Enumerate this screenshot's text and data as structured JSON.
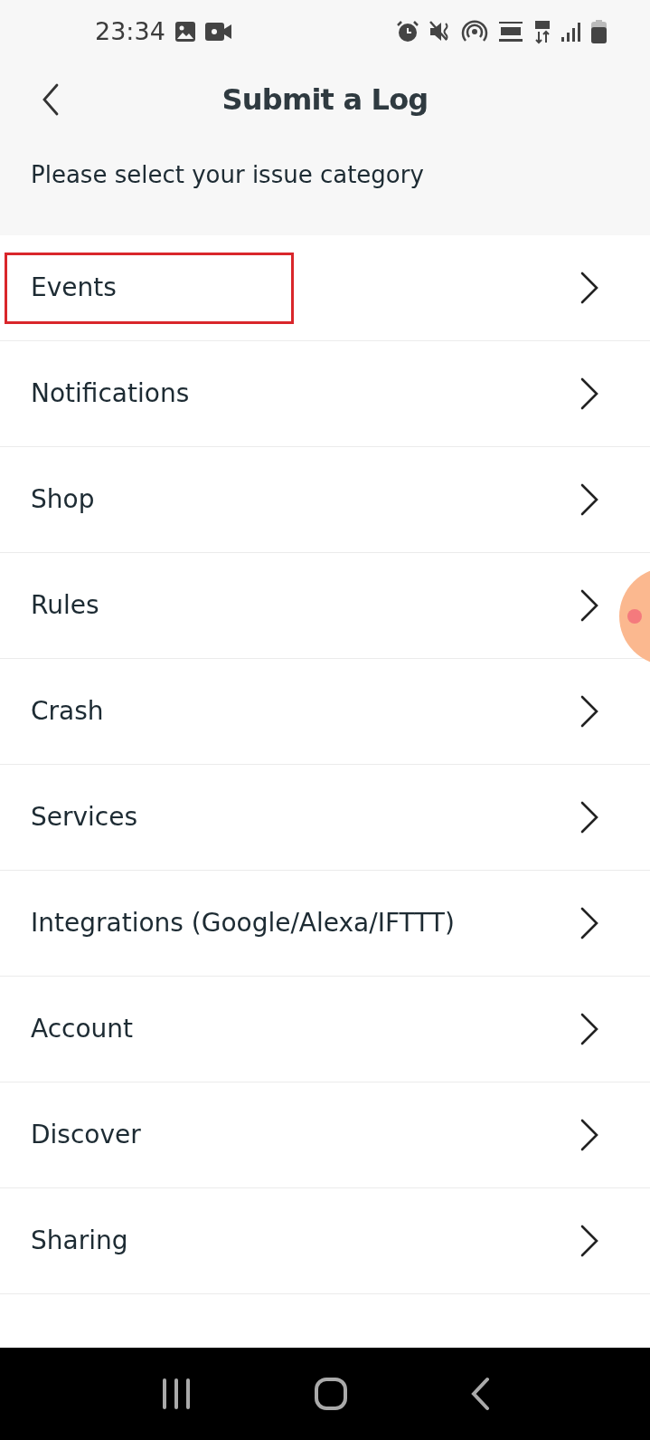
{
  "status_bar": {
    "time": "23:34"
  },
  "header": {
    "title": "Submit a Log",
    "subtitle": "Please select your issue category"
  },
  "categories": [
    {
      "label": "Events",
      "highlighted": true
    },
    {
      "label": "Notifications",
      "highlighted": false
    },
    {
      "label": "Shop",
      "highlighted": false
    },
    {
      "label": "Rules",
      "highlighted": false
    },
    {
      "label": "Crash",
      "highlighted": false
    },
    {
      "label": "Services",
      "highlighted": false
    },
    {
      "label": "Integrations (Google/Alexa/IFTTT)",
      "highlighted": false
    },
    {
      "label": "Account",
      "highlighted": false
    },
    {
      "label": "Discover",
      "highlighted": false
    },
    {
      "label": "Sharing",
      "highlighted": false
    }
  ]
}
